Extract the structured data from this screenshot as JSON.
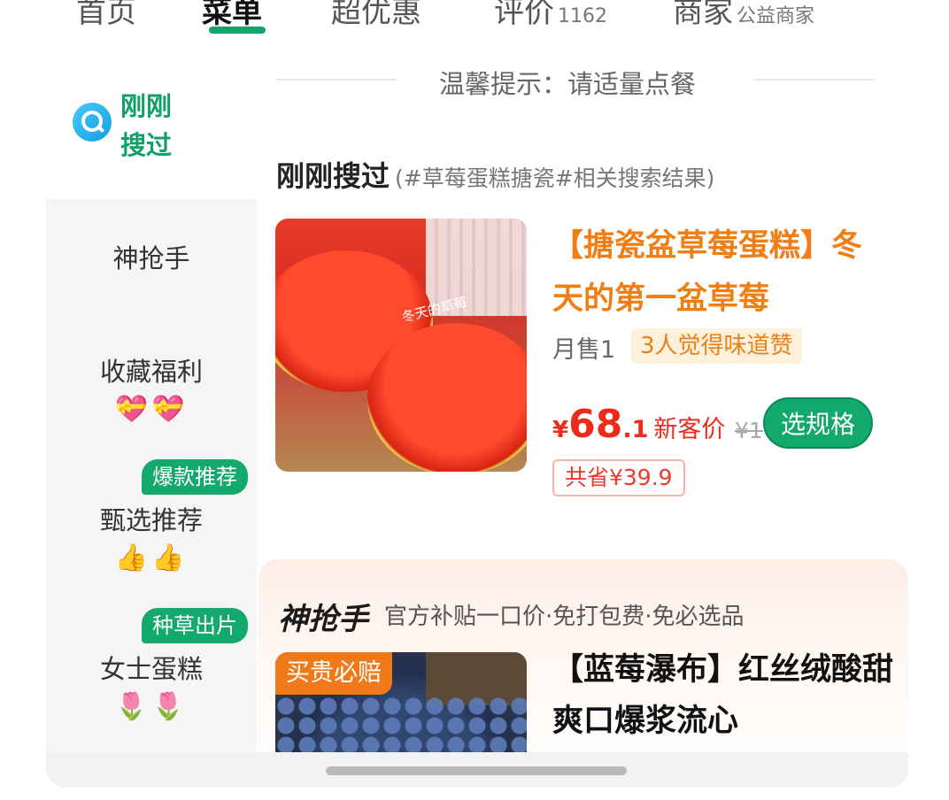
{
  "tabs": [
    {
      "label": "首页",
      "sub": ""
    },
    {
      "label": "菜单",
      "sub": ""
    },
    {
      "label": "超优惠",
      "sub": ""
    },
    {
      "label": "评价",
      "sub": "1162"
    },
    {
      "label": "商家",
      "sub": "公益商家"
    }
  ],
  "accent_color": "#14a56b",
  "notice": "温馨提示：请适量点餐",
  "sidebar": {
    "recent_label": "刚刚搜过",
    "items": [
      {
        "label": "神抢手",
        "emoji": "",
        "badge": ""
      },
      {
        "label": "收藏福利",
        "emoji": "💝💝",
        "badge": ""
      },
      {
        "label": "甄选推荐",
        "emoji": "👍👍",
        "badge": "爆款推荐"
      },
      {
        "label": "女士蛋糕",
        "emoji": "🌷🌷",
        "badge": "种草出片"
      }
    ]
  },
  "recent_section": {
    "title": "刚刚搜过",
    "subtitle": "(#草莓蛋糕搪瓷#相关搜索结果)"
  },
  "product1": {
    "title": "【搪瓷盆草莓蛋糕】冬天的第一盆草莓",
    "image_caption": "冬天的草莓",
    "sold": "月售1",
    "review_chip": "3人觉得味道赞",
    "price_currency": "¥",
    "price_integer": "68",
    "price_decimal": ".1",
    "price_label": "新客价",
    "original_price": "¥1",
    "spec_button": "选规格",
    "savings": "共省¥39.9"
  },
  "promo": {
    "logo": "神抢手",
    "desc": "官方补贴一口价·免打包费·免必选品",
    "image_badge": "买贵必赔",
    "product_title": "【蓝莓瀑布】红丝绒酸甜爽口爆浆流心"
  }
}
